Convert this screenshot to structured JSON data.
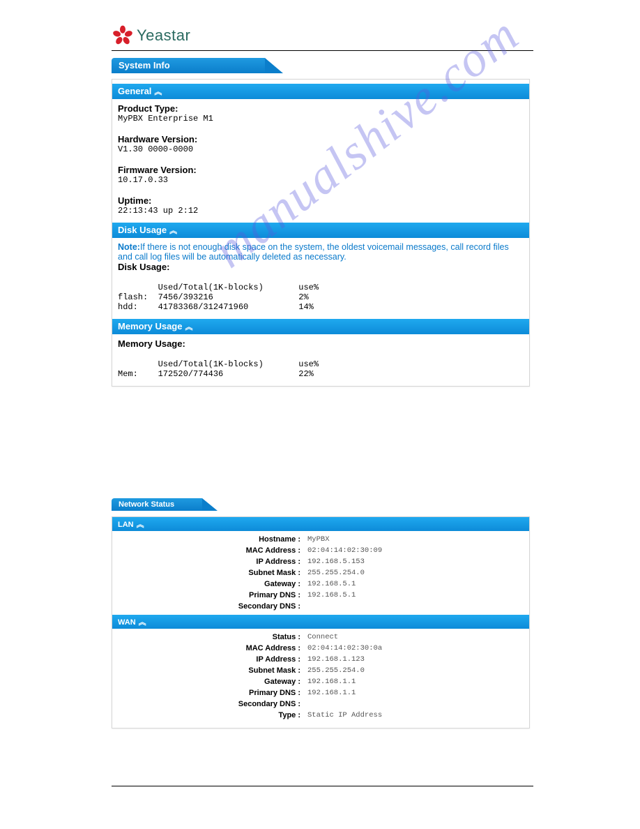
{
  "brand": {
    "name": "Yeastar"
  },
  "watermark": "manualshive.com",
  "section1": {
    "title": "System Info",
    "general": {
      "header": "General",
      "product_type_label": "Product Type:",
      "product_type": "MyPBX Enterprise M1",
      "hardware_label": "Hardware Version:",
      "hardware": "V1.30 0000-0000",
      "firmware_label": "Firmware Version:",
      "firmware": "10.17.0.33",
      "uptime_label": "Uptime:",
      "uptime": "22:13:43 up 2:12"
    },
    "disk": {
      "header": "Disk Usage",
      "note_prefix": "Note:",
      "note": "If there is not enough disk space on the system, the oldest voicemail messages, call record files and call log files will be automatically deleted as necessary.",
      "label": "Disk Usage:",
      "col_head": "        Used/Total(1K-blocks)       use%",
      "row1": "flash:  7456/393216                 2%",
      "row2": "hdd:    41783368/312471960          14%"
    },
    "memory": {
      "header": "Memory Usage",
      "label": "Memory Usage:",
      "col_head": "        Used/Total(1K-blocks)       use%",
      "row1": "Mem:    172520/774436               22%"
    }
  },
  "section2": {
    "title": "Network Status",
    "lan": {
      "header": "LAN",
      "rows": [
        {
          "label": "Hostname :",
          "value": "MyPBX"
        },
        {
          "label": "MAC Address :",
          "value": "02:04:14:02:30:09"
        },
        {
          "label": "IP Address :",
          "value": "192.168.5.153"
        },
        {
          "label": "Subnet Mask :",
          "value": "255.255.254.0"
        },
        {
          "label": "Gateway :",
          "value": "192.168.5.1"
        },
        {
          "label": "Primary DNS :",
          "value": "192.168.5.1"
        },
        {
          "label": "Secondary DNS :",
          "value": ""
        }
      ]
    },
    "wan": {
      "header": "WAN",
      "rows": [
        {
          "label": "Status :",
          "value": "Connect"
        },
        {
          "label": "MAC Address :",
          "value": "02:04:14:02:30:0a"
        },
        {
          "label": "IP Address :",
          "value": "192.168.1.123"
        },
        {
          "label": "Subnet Mask :",
          "value": "255.255.254.0"
        },
        {
          "label": "Gateway :",
          "value": "192.168.1.1"
        },
        {
          "label": "Primary DNS :",
          "value": "192.168.1.1"
        },
        {
          "label": "Secondary DNS :",
          "value": ""
        },
        {
          "label": "Type :",
          "value": "Static IP Address"
        }
      ]
    }
  }
}
